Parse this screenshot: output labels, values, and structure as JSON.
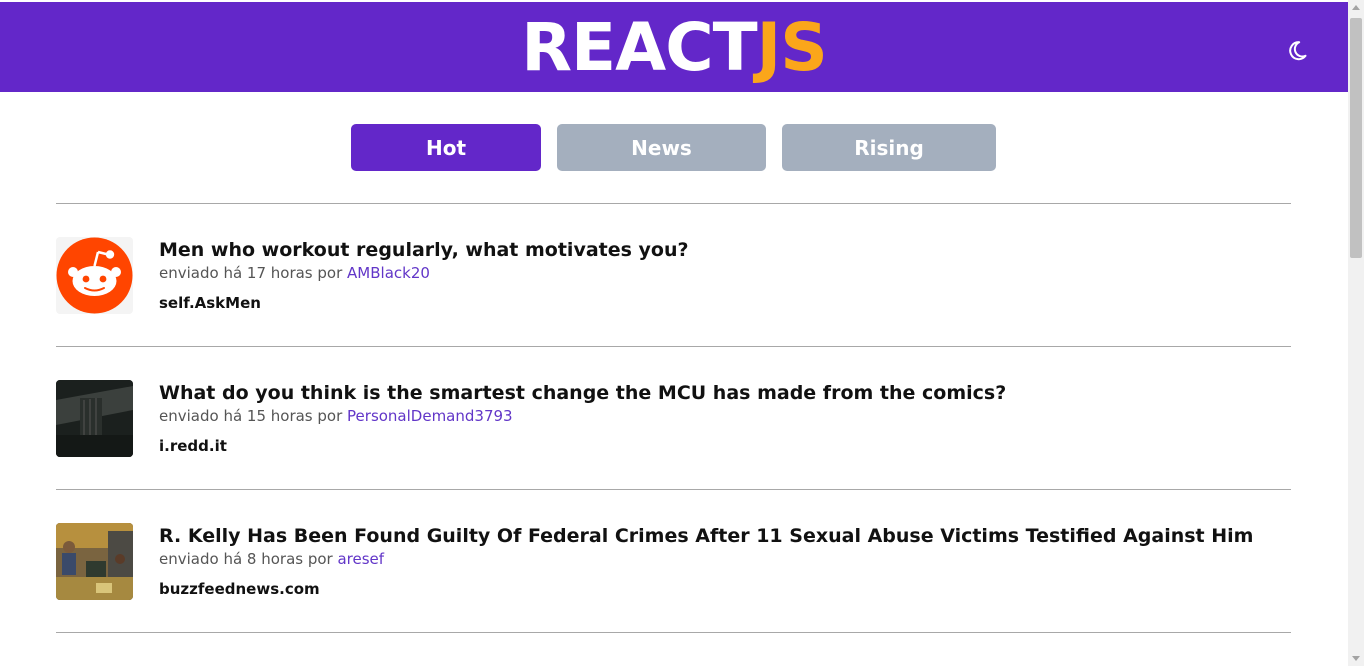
{
  "header": {
    "logo_part1": "REACT",
    "logo_part2": "JS",
    "theme_toggle_icon": "moon-icon",
    "colors": {
      "background": "#6327c9",
      "logo_main": "#ffffff",
      "logo_accent": "#fba61a"
    }
  },
  "tabs": [
    {
      "label": "Hot",
      "active": true
    },
    {
      "label": "News",
      "active": false
    },
    {
      "label": "Rising",
      "active": false
    }
  ],
  "posts": [
    {
      "title": "Men who workout regularly, what motivates you?",
      "meta_prefix": "enviado há 17 horas por ",
      "author": "AMBlack20",
      "domain": "self.AskMen",
      "thumbnail": "reddit-logo"
    },
    {
      "title": "What do you think is the smartest change the MCU has made from the comics?",
      "meta_prefix": "enviado há 15 horas por ",
      "author": "PersonalDemand3793",
      "domain": "i.redd.it",
      "thumbnail": "dark-image"
    },
    {
      "title": "R. Kelly Has Been Found Guilty Of Federal Crimes After 11 Sexual Abuse Victims Testified Against Him",
      "meta_prefix": "enviado há 8 horas por ",
      "author": "aresef",
      "domain": "buzzfeednews.com",
      "thumbnail": "courtroom-image"
    }
  ],
  "colors": {
    "accent": "#6327c9",
    "inactive_tab": "#a4afbe",
    "author_link": "#6236c8",
    "divider": "#a8a8a8"
  }
}
